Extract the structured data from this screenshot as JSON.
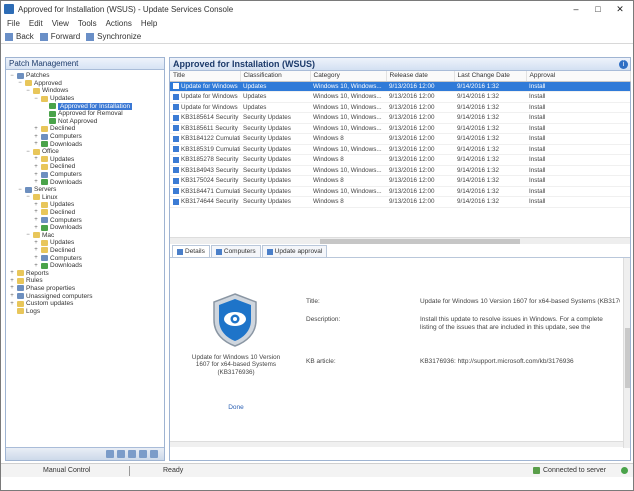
{
  "window": {
    "title": "Approved for Installation (WSUS) - Update Services Console",
    "controls": [
      "–",
      "□",
      "✕"
    ]
  },
  "menu": [
    "File",
    "Edit",
    "View",
    "Tools",
    "Actions",
    "Help"
  ],
  "toolbar": {
    "items": [
      "Back",
      "Forward",
      "Synchronize"
    ]
  },
  "left_pane": {
    "title": "Patch Management",
    "tree": [
      {
        "label": "Patches",
        "level": 0,
        "icon": "comp",
        "exp": "−"
      },
      {
        "label": "Approved",
        "level": 1,
        "icon": "folder",
        "exp": "−"
      },
      {
        "label": "Windows",
        "level": 2,
        "icon": "folder",
        "exp": "−"
      },
      {
        "label": "Updates",
        "level": 3,
        "icon": "folder",
        "exp": "−"
      },
      {
        "label": "Approved for Installation",
        "level": 4,
        "icon": "green",
        "exp": "",
        "selected": true
      },
      {
        "label": "Approved for Removal",
        "level": 4,
        "icon": "green",
        "exp": ""
      },
      {
        "label": "Not Approved",
        "level": 4,
        "icon": "green",
        "exp": ""
      },
      {
        "label": "Declined",
        "level": 3,
        "icon": "folder",
        "exp": "+"
      },
      {
        "label": "Computers",
        "level": 3,
        "icon": "comp",
        "exp": "+"
      },
      {
        "label": "Downloads",
        "level": 3,
        "icon": "green",
        "exp": "+"
      },
      {
        "label": "Office",
        "level": 2,
        "icon": "folder",
        "exp": "−"
      },
      {
        "label": "Updates",
        "level": 3,
        "icon": "folder",
        "exp": "+"
      },
      {
        "label": "Declined",
        "level": 3,
        "icon": "folder",
        "exp": "+"
      },
      {
        "label": "Computers",
        "level": 3,
        "icon": "comp",
        "exp": "+"
      },
      {
        "label": "Downloads",
        "level": 3,
        "icon": "green",
        "exp": "+"
      },
      {
        "label": "Servers",
        "level": 1,
        "icon": "comp",
        "exp": "−"
      },
      {
        "label": "Linux",
        "level": 2,
        "icon": "folder",
        "exp": "−"
      },
      {
        "label": "Updates",
        "level": 3,
        "icon": "folder",
        "exp": "+"
      },
      {
        "label": "Declined",
        "level": 3,
        "icon": "folder",
        "exp": "+"
      },
      {
        "label": "Computers",
        "level": 3,
        "icon": "comp",
        "exp": "+"
      },
      {
        "label": "Downloads",
        "level": 3,
        "icon": "green",
        "exp": "+"
      },
      {
        "label": "Mac",
        "level": 2,
        "icon": "folder",
        "exp": "−"
      },
      {
        "label": "Updates",
        "level": 3,
        "icon": "folder",
        "exp": "+"
      },
      {
        "label": "Declined",
        "level": 3,
        "icon": "folder",
        "exp": "+"
      },
      {
        "label": "Computers",
        "level": 3,
        "icon": "comp",
        "exp": "+"
      },
      {
        "label": "Downloads",
        "level": 3,
        "icon": "green",
        "exp": "+"
      },
      {
        "label": "Reports",
        "level": 0,
        "icon": "folder",
        "exp": "+"
      },
      {
        "label": "Rules",
        "level": 0,
        "icon": "folder",
        "exp": "+"
      },
      {
        "label": "Phase properties",
        "level": 0,
        "icon": "comp",
        "exp": "+"
      },
      {
        "label": "Unassigned computers",
        "level": 0,
        "icon": "comp",
        "exp": "+"
      },
      {
        "label": "Custom updates",
        "level": 0,
        "icon": "folder",
        "exp": "+"
      },
      {
        "label": "Logs",
        "level": 0,
        "icon": "folder",
        "exp": ""
      }
    ]
  },
  "main": {
    "title": "Approved for Installation (WSUS)",
    "columns": [
      "Title",
      "Classification",
      "Category",
      "Release date",
      "Last Change Date",
      "Approval"
    ],
    "rows": [
      {
        "title": "Update for Windows 10 Version",
        "classification": "Updates",
        "category": "Windows 10, Windows...",
        "release": "9/13/2016 12:00",
        "changed": "9/14/2016 1:32",
        "approval": "Install",
        "selected": true
      },
      {
        "title": "Update for Windows Server",
        "classification": "Updates",
        "category": "Windows 10, Windows...",
        "release": "9/13/2016 12:00",
        "changed": "9/14/2016 1:32",
        "approval": "Install"
      },
      {
        "title": "Update for Windows 10",
        "classification": "Updates",
        "category": "Windows 10, Windows...",
        "release": "9/13/2016 12:00",
        "changed": "9/14/2016 1:32",
        "approval": "Install"
      },
      {
        "title": "KB3185614 Security Update",
        "classification": "Security Updates",
        "category": "Windows 10, Windows...",
        "release": "9/13/2016 12:00",
        "changed": "9/14/2016 1:32",
        "approval": "Install"
      },
      {
        "title": "KB3185611 Security Update",
        "classification": "Security Updates",
        "category": "Windows 10, Windows...",
        "release": "9/13/2016 12:00",
        "changed": "9/14/2016 1:32",
        "approval": "Install"
      },
      {
        "title": "KB3184122 Cumulative Update",
        "classification": "Security Updates",
        "category": "Windows 8",
        "release": "9/13/2016 12:00",
        "changed": "9/14/2016 1:32",
        "approval": "Install"
      },
      {
        "title": "KB3185319 Cumulative Update",
        "classification": "Security Updates",
        "category": "Windows 10, Windows...",
        "release": "9/13/2016 12:00",
        "changed": "9/14/2016 1:32",
        "approval": "Install"
      },
      {
        "title": "KB3185278 Security Update",
        "classification": "Security Updates",
        "category": "Windows 8",
        "release": "9/13/2016 12:00",
        "changed": "9/14/2016 1:32",
        "approval": "Install"
      },
      {
        "title": "KB3184943 Security Update",
        "classification": "Security Updates",
        "category": "Windows 10, Windows...",
        "release": "9/13/2016 12:00",
        "changed": "9/14/2016 1:32",
        "approval": "Install"
      },
      {
        "title": "KB3175024 Security Update",
        "classification": "Security Updates",
        "category": "Windows 8",
        "release": "9/13/2016 12:00",
        "changed": "9/14/2016 1:32",
        "approval": "Install"
      },
      {
        "title": "KB3184471 Cumulative Update",
        "classification": "Security Updates",
        "category": "Windows 10, Windows...",
        "release": "9/13/2016 12:00",
        "changed": "9/14/2016 1:32",
        "approval": "Install"
      },
      {
        "title": "KB3174644 Security Update",
        "classification": "Security Updates",
        "category": "Windows 8",
        "release": "9/13/2016 12:00",
        "changed": "9/14/2016 1:32",
        "approval": "Install"
      }
    ],
    "tabs": [
      "Details",
      "Computers",
      "Update approval"
    ],
    "details": {
      "update_title": "Update for Windows 10 Version 1607 for x64-based Systems (KB3176936)",
      "status": "Done",
      "labels": [
        "Title:",
        "Description:",
        "KB article:"
      ],
      "values": [
        "Update for Windows 10 Version 1607 for x64-based Systems (KB3176936)",
        "Install this update to resolve issues in Windows. For a complete listing of the issues that are included in this update, see the associated Microsoft Knowledge Base article.",
        "KB3176936: http://support.microsoft.com/kb/3176936"
      ]
    }
  },
  "statusbar": {
    "left": "Manual Control",
    "middle": "Ready",
    "right": "Connected to server"
  }
}
